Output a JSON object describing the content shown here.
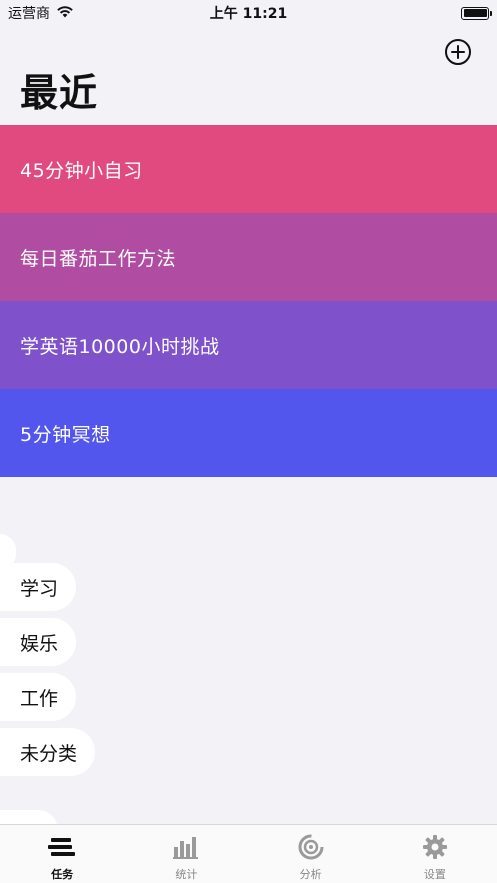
{
  "status_bar": {
    "carrier": "运营商",
    "time": "上午 11:21"
  },
  "header": {
    "title": "最近",
    "add_icon": "plus-circle-icon"
  },
  "recent": [
    {
      "label": "45分钟小自习",
      "color": "#e04a7f"
    },
    {
      "label": "每日番茄工作方法",
      "color": "#b04da3"
    },
    {
      "label": "学英语10000小时挑战",
      "color": "#7f52cc"
    },
    {
      "label": "5分钟冥想",
      "color": "#5356ec"
    }
  ],
  "categories": [
    {
      "label": "学习"
    },
    {
      "label": "娱乐"
    },
    {
      "label": "工作"
    },
    {
      "label": "未分类"
    }
  ],
  "tabs": [
    {
      "label": "任务",
      "icon": "tasks-icon",
      "active": true
    },
    {
      "label": "统计",
      "icon": "bar-chart-icon",
      "active": false
    },
    {
      "label": "分析",
      "icon": "ring-chart-icon",
      "active": false
    },
    {
      "label": "设置",
      "icon": "gear-icon",
      "active": false
    }
  ]
}
